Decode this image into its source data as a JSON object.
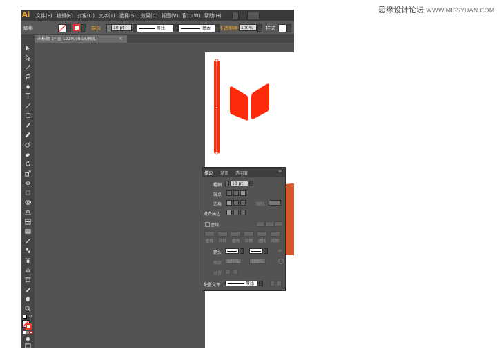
{
  "watermark": {
    "text": "思缘设计论坛",
    "site": "WWW.MISSYUAN.COM"
  },
  "app": {
    "logo": "Ai"
  },
  "menubar": {
    "items": [
      "文件(F)",
      "编辑(E)",
      "对象(O)",
      "文字(T)",
      "选择(S)",
      "效果(C)",
      "视图(V)",
      "窗口(W)",
      "帮助(H)"
    ]
  },
  "control_bar": {
    "selection_label": "编组",
    "stroke_label": "描边",
    "stroke_weight": "10 pt",
    "profile_label": "等比",
    "brush_label": "基本",
    "opacity_label": "不透明度",
    "opacity_value": "100%",
    "style_label": "样式"
  },
  "document_tab": {
    "title": "未标题-1* @ 122% (RGB/预览)"
  },
  "panel": {
    "tabs": [
      "描边",
      "渐变",
      "透明度"
    ],
    "weight_label": "粗细",
    "weight_value": "10 pt",
    "cap_label": "端点",
    "corner_label": "边角",
    "limit_label": "限制",
    "align_label": "对齐描边",
    "dashed_label": "虚线",
    "dash_labels": [
      "虚线",
      "间隙",
      "虚线",
      "间隙",
      "虚线",
      "间隙"
    ],
    "arrow_label": "箭头",
    "scale_label": "缩放",
    "scale_value1": "100%",
    "scale_value2": "100%",
    "align_arrow_label": "对齐",
    "profile_label": "配置文件",
    "profile_value": "等比"
  },
  "colors": {
    "accent_red": "#ff2a0a",
    "shape_red": "#e8401c",
    "circle_orange": "#d45a2e",
    "ui_dark": "#535353"
  }
}
